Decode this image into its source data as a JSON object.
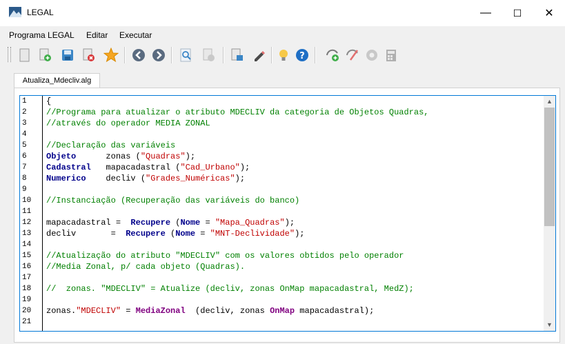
{
  "window": {
    "title": "LEGAL",
    "minimize": "—",
    "maximize": "☐",
    "close": "✕"
  },
  "menu": [
    "Programa LEGAL",
    "Editar",
    "Executar"
  ],
  "toolbar_icons": [
    "new-file-icon",
    "new-add-icon",
    "save-icon",
    "close-file-icon",
    "favorite-star-icon",
    "back-arrow-icon",
    "forward-arrow-icon",
    "search-icon",
    "disabled-tool-icon",
    "import-icon",
    "pencil-icon",
    "lightbulb-icon",
    "help-icon",
    "run-green-icon",
    "edit-check-icon",
    "gear-icon",
    "calculator-icon"
  ],
  "tab": {
    "label": "Atualiza_Mdecliv.alg"
  },
  "editor": {
    "line_numbers": [
      "1",
      "2",
      "3",
      "4",
      "5",
      "6",
      "7",
      "8",
      "9",
      "10",
      "11",
      "12",
      "13",
      "14",
      "15",
      "16",
      "17",
      "18",
      "19",
      "20",
      "21"
    ],
    "lines": [
      [
        {
          "t": "{",
          "c": ""
        }
      ],
      [
        {
          "t": "//Programa para atualizar o atributo MDECLIV da categoria de Objetos Quadras,",
          "c": "cmt"
        }
      ],
      [
        {
          "t": "//através do operador MEDIA ZONAL",
          "c": "cmt"
        }
      ],
      [
        {
          "t": "",
          "c": ""
        }
      ],
      [
        {
          "t": "//Declaração das variáveis",
          "c": "cmt"
        }
      ],
      [
        {
          "t": "Objeto",
          "c": "kw"
        },
        {
          "t": "      zonas (",
          "c": ""
        },
        {
          "t": "\"Quadras\"",
          "c": "str"
        },
        {
          "t": ");",
          "c": ""
        }
      ],
      [
        {
          "t": "Cadastral",
          "c": "kw"
        },
        {
          "t": "   mapacadastral (",
          "c": ""
        },
        {
          "t": "\"Cad_Urbano\"",
          "c": "str"
        },
        {
          "t": ");",
          "c": ""
        }
      ],
      [
        {
          "t": "Numerico",
          "c": "kw"
        },
        {
          "t": "    decliv (",
          "c": ""
        },
        {
          "t": "\"Grades_Numéricas\"",
          "c": "str"
        },
        {
          "t": ");",
          "c": ""
        }
      ],
      [
        {
          "t": "",
          "c": ""
        }
      ],
      [
        {
          "t": "//Instanciação (Recuperação das variáveis do banco)",
          "c": "cmt"
        }
      ],
      [
        {
          "t": "",
          "c": ""
        }
      ],
      [
        {
          "t": "mapacadastral =  ",
          "c": ""
        },
        {
          "t": "Recupere",
          "c": "kw"
        },
        {
          "t": " (",
          "c": ""
        },
        {
          "t": "Nome",
          "c": "kw"
        },
        {
          "t": " = ",
          "c": ""
        },
        {
          "t": "\"Mapa_Quadras\"",
          "c": "str"
        },
        {
          "t": ");",
          "c": ""
        }
      ],
      [
        {
          "t": "decliv       =  ",
          "c": ""
        },
        {
          "t": "Recupere",
          "c": "kw"
        },
        {
          "t": " (",
          "c": ""
        },
        {
          "t": "Nome",
          "c": "kw"
        },
        {
          "t": " = ",
          "c": ""
        },
        {
          "t": "\"MNT-Declividade\"",
          "c": "str"
        },
        {
          "t": ");",
          "c": ""
        }
      ],
      [
        {
          "t": "",
          "c": ""
        }
      ],
      [
        {
          "t": "//Atualização do atributo \"MDECLIV\" com os valores obtidos pelo operador",
          "c": "cmt"
        }
      ],
      [
        {
          "t": "//Media Zonal, p/ cada objeto (Quadras).",
          "c": "cmt"
        }
      ],
      [
        {
          "t": "",
          "c": ""
        }
      ],
      [
        {
          "t": "//  zonas. \"MDECLIV\" = Atualize (decliv, zonas OnMap mapacadastral, MedZ);",
          "c": "cmt"
        }
      ],
      [
        {
          "t": "",
          "c": ""
        }
      ],
      [
        {
          "t": "zonas.",
          "c": ""
        },
        {
          "t": "\"MDECLIV\"",
          "c": "str"
        },
        {
          "t": " = ",
          "c": ""
        },
        {
          "t": "MediaZonal",
          "c": "prp"
        },
        {
          "t": "  (decliv, zonas ",
          "c": ""
        },
        {
          "t": "OnMap",
          "c": "prp"
        },
        {
          "t": " mapacadastral);",
          "c": ""
        }
      ],
      [
        {
          "t": "",
          "c": ""
        }
      ]
    ]
  }
}
